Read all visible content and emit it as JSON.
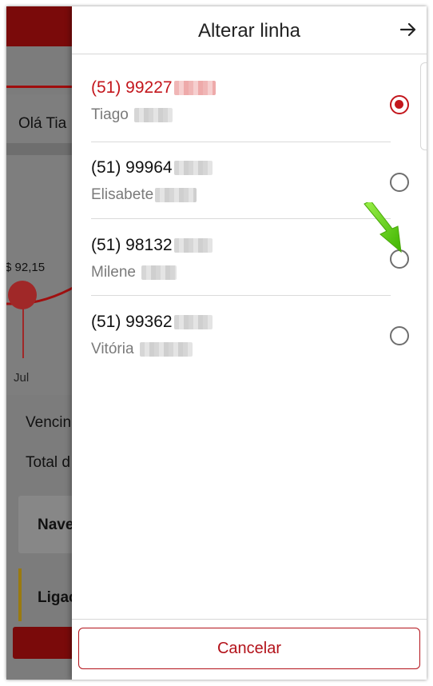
{
  "background": {
    "greeting": "Olá Tia",
    "price": "$ 92,15",
    "month": "Jul",
    "rows": [
      "Vencin",
      "Total d"
    ],
    "cards": [
      "Nave",
      "Ligac"
    ]
  },
  "drawer": {
    "title": "Alterar linha",
    "lines": [
      {
        "number": "(51) 99227",
        "name": "Tiago",
        "selected": true
      },
      {
        "number": "(51) 99964",
        "name": "Elisabete",
        "selected": false
      },
      {
        "number": "(51) 98132",
        "name": "Milene",
        "selected": false
      },
      {
        "number": "(51) 99362",
        "name": "Vitória",
        "selected": false
      }
    ],
    "cancel_label": "Cancelar"
  },
  "colors": {
    "accent": "#c3161c",
    "dark_red": "#7a0a0a",
    "pointer": "#6bd40f"
  },
  "icons": [
    "arrow-right-icon",
    "radio-selected-icon",
    "radio-unselected-icon",
    "green-pointer-arrow-icon"
  ]
}
